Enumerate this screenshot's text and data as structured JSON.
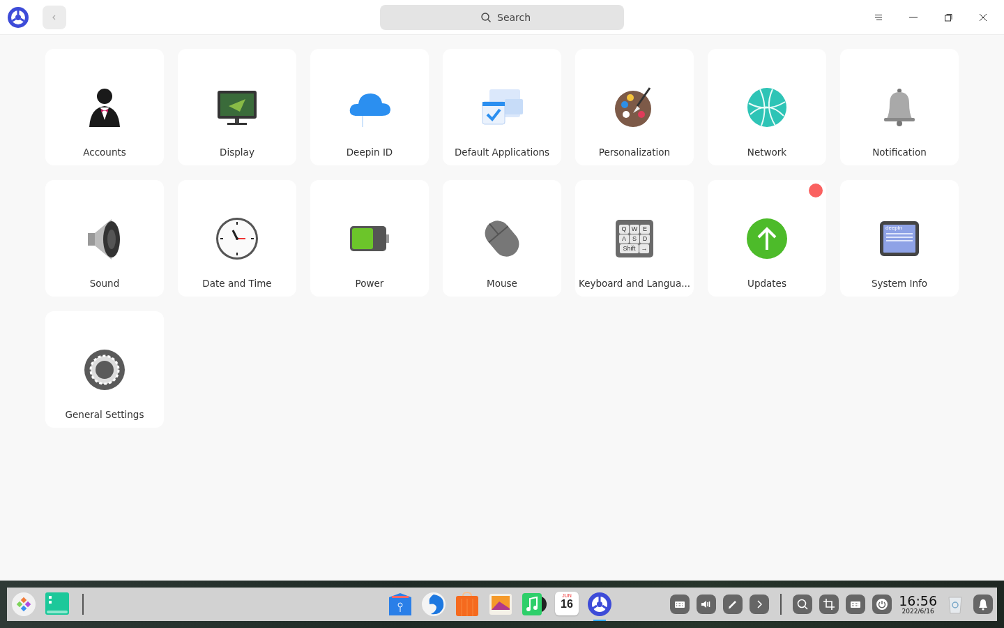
{
  "titlebar": {
    "search": {
      "placeholder": "Search"
    }
  },
  "modules": [
    {
      "kind": "accounts",
      "label": "Accounts",
      "badge": false
    },
    {
      "kind": "display",
      "label": "Display",
      "badge": false
    },
    {
      "kind": "cloud",
      "label": "Deepin ID",
      "badge": false
    },
    {
      "kind": "default-apps",
      "label": "Default Applications",
      "badge": false
    },
    {
      "kind": "palette",
      "label": "Personalization",
      "badge": false
    },
    {
      "kind": "network",
      "label": "Network",
      "badge": false
    },
    {
      "kind": "bell",
      "label": "Notification",
      "badge": false
    },
    {
      "kind": "sound",
      "label": "Sound",
      "badge": false
    },
    {
      "kind": "clock",
      "label": "Date and Time",
      "badge": false
    },
    {
      "kind": "power",
      "label": "Power",
      "badge": false
    },
    {
      "kind": "mouse",
      "label": "Mouse",
      "badge": false
    },
    {
      "kind": "keyboard",
      "label": "Keyboard and Langua...",
      "badge": false,
      "keys": [
        "Q",
        "W",
        "E",
        "A",
        "S",
        "D",
        "Shift",
        "→"
      ]
    },
    {
      "kind": "updates",
      "label": "Updates",
      "badge": true
    },
    {
      "kind": "sysinfo",
      "label": "System Info",
      "badge": false,
      "screen_text": "deepin"
    },
    {
      "kind": "gear",
      "label": "General Settings",
      "badge": false
    }
  ],
  "taskbar": {
    "left": [
      {
        "kind": "launcher"
      },
      {
        "kind": "terminal"
      }
    ],
    "apps": [
      {
        "kind": "files",
        "active": false
      },
      {
        "kind": "browser",
        "active": false
      },
      {
        "kind": "store",
        "active": false
      },
      {
        "kind": "photos",
        "active": false
      },
      {
        "kind": "music",
        "active": false
      },
      {
        "kind": "calendar",
        "active": false,
        "month": "JUN",
        "day": "16"
      },
      {
        "kind": "settings",
        "active": true
      }
    ],
    "tray": [
      {
        "kind": "keyboard"
      },
      {
        "kind": "volume"
      },
      {
        "kind": "pen"
      },
      {
        "kind": "chevron"
      },
      {
        "kind": "separator"
      },
      {
        "kind": "search"
      },
      {
        "kind": "screenshot"
      },
      {
        "kind": "onscreen-keyboard"
      },
      {
        "kind": "power"
      }
    ],
    "clock": {
      "time": "16:56",
      "date": "2022/6/16"
    }
  }
}
